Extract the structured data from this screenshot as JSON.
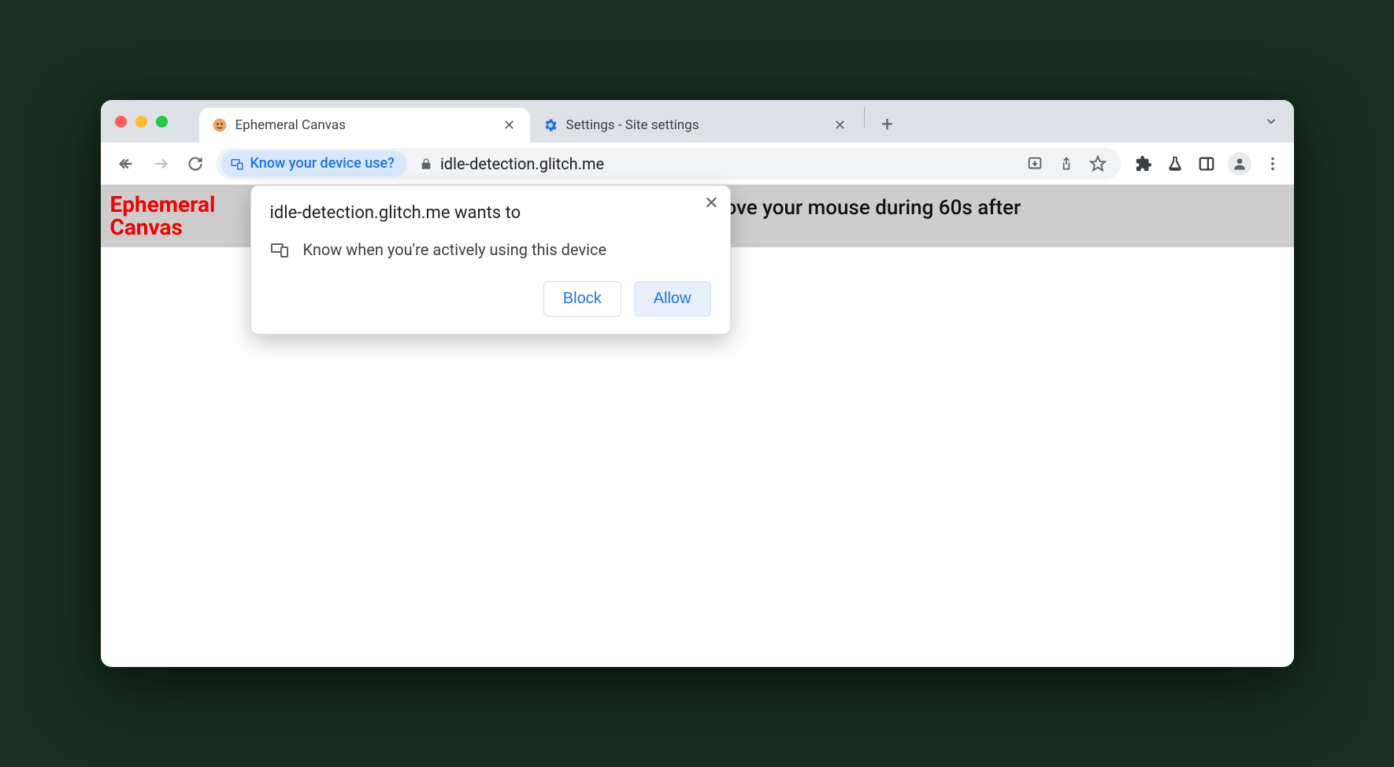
{
  "tabs": {
    "active": {
      "title": "Ephemeral Canvas"
    },
    "inactive": {
      "title": "Settings - Site settings"
    }
  },
  "omnibox": {
    "chip_label": "Know your device use?",
    "url": "idle-detection.glitch.me"
  },
  "page": {
    "site_title_line1": "Ephemeral",
    "site_title_line2": "Canvas",
    "banner_message": "Don't move your mouse during 60s after"
  },
  "permission": {
    "title": "idle-detection.glitch.me wants to",
    "detail": "Know when you're actively using this device",
    "block_label": "Block",
    "allow_label": "Allow"
  }
}
